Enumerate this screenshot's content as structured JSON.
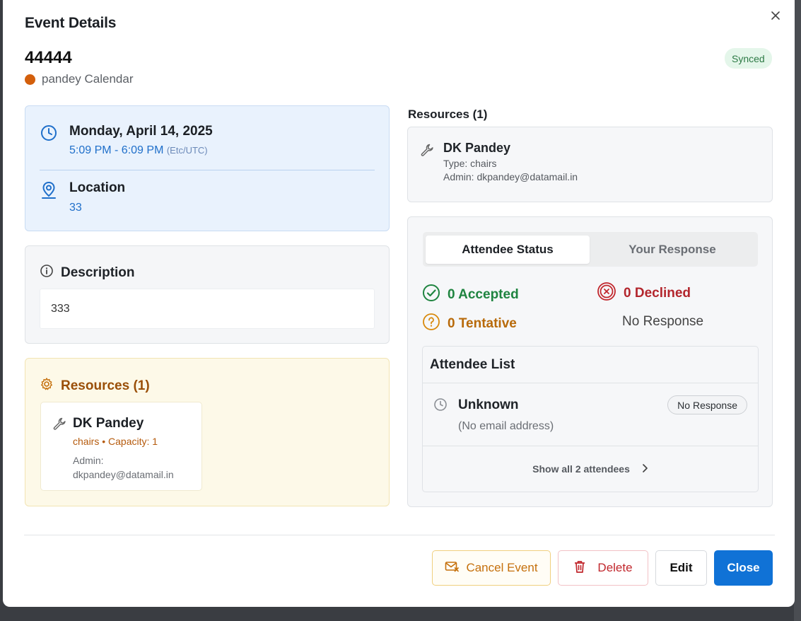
{
  "modal": {
    "title": "Event Details",
    "event_title": "44444",
    "calendar_name": "pandey Calendar",
    "calendar_color": "#d35f0c",
    "sync_status": "Synced"
  },
  "datetime": {
    "date": "Monday, April 14, 2025",
    "time_range": "5:09 PM - 6:09 PM",
    "timezone": "(Etc/UTC)",
    "location_label": "Location",
    "location_value": "33"
  },
  "description": {
    "label": "Description",
    "text": "333"
  },
  "resources_left": {
    "label": "Resources (1)",
    "items": [
      {
        "name": "DK Pandey",
        "meta": "chairs • Capacity: 1",
        "admin": "Admin: dkpandey@datamail.in"
      }
    ]
  },
  "resources_right": {
    "label": "Resources (1)",
    "items": [
      {
        "name": "DK Pandey",
        "type": "Type: chairs",
        "admin": "Admin: dkpandey@datamail.in"
      }
    ]
  },
  "attendees": {
    "tabs": [
      {
        "label": "Attendee Status",
        "active": true
      },
      {
        "label": "Your Response",
        "active": false
      }
    ],
    "stats": {
      "accepted": "0 Accepted",
      "declined": "0 Declined",
      "tentative": "0 Tentative",
      "no_response": "No Response"
    },
    "list_title": "Attendee List",
    "rows": [
      {
        "name": "Unknown",
        "email": "(No email address)",
        "status": "No Response"
      }
    ],
    "show_all": "Show all 2 attendees"
  },
  "footer": {
    "cancel_event": "Cancel Event",
    "delete": "Delete",
    "edit": "Edit",
    "close": "Close"
  },
  "colors": {
    "primary": "#1072d6",
    "accepted": "#1f8440",
    "declined": "#b3262d",
    "tentative": "#b86a0a"
  }
}
